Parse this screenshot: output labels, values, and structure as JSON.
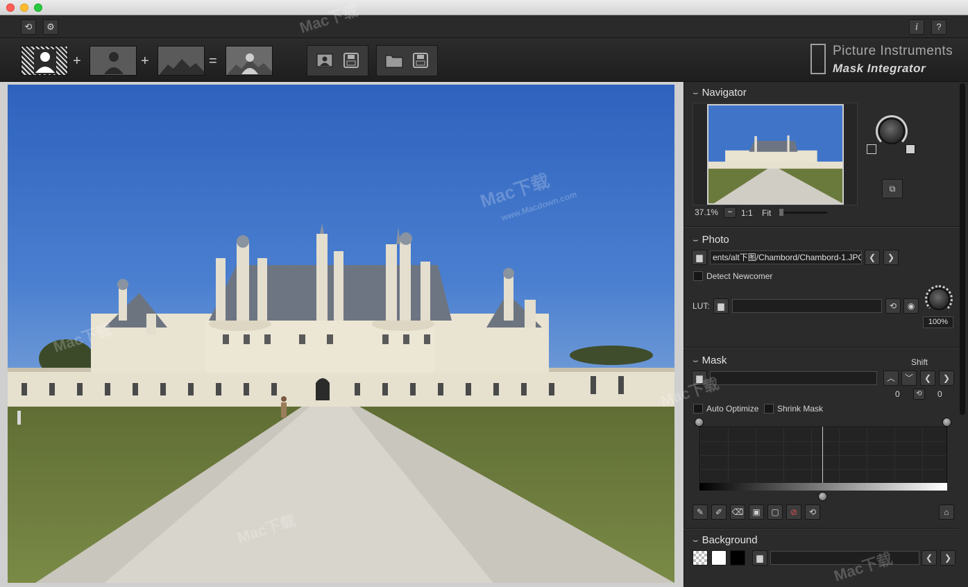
{
  "window": {
    "title": ""
  },
  "toolbar": {
    "reset_icon": "reset-icon",
    "settings_icon": "gear-icon",
    "info_label": "i",
    "help_label": "?",
    "plus1": "+",
    "plus2": "+",
    "equals": "="
  },
  "brand": {
    "line1": "Picture Instruments",
    "line2": "Mask Integrator"
  },
  "navigator": {
    "title": "Navigator",
    "zoom": "37.1%",
    "one_to_one": "1:1",
    "fit": "Fit"
  },
  "photo": {
    "title": "Photo",
    "path": "ents/alt下图/Chambord/Chambord-1.JPG",
    "detect_newcomer": "Detect Newcomer",
    "lut_label": "LUT:",
    "lut_value": "",
    "knob_value": "100%"
  },
  "mask": {
    "title": "Mask",
    "shift_label": "Shift",
    "shift_left": "0",
    "shift_right": "0",
    "auto_optimize": "Auto Optimize",
    "shrink_mask": "Shrink Mask"
  },
  "background": {
    "title": "Background"
  },
  "watermark": {
    "brand": "Mac下载",
    "url": "www.Macdown.com"
  }
}
